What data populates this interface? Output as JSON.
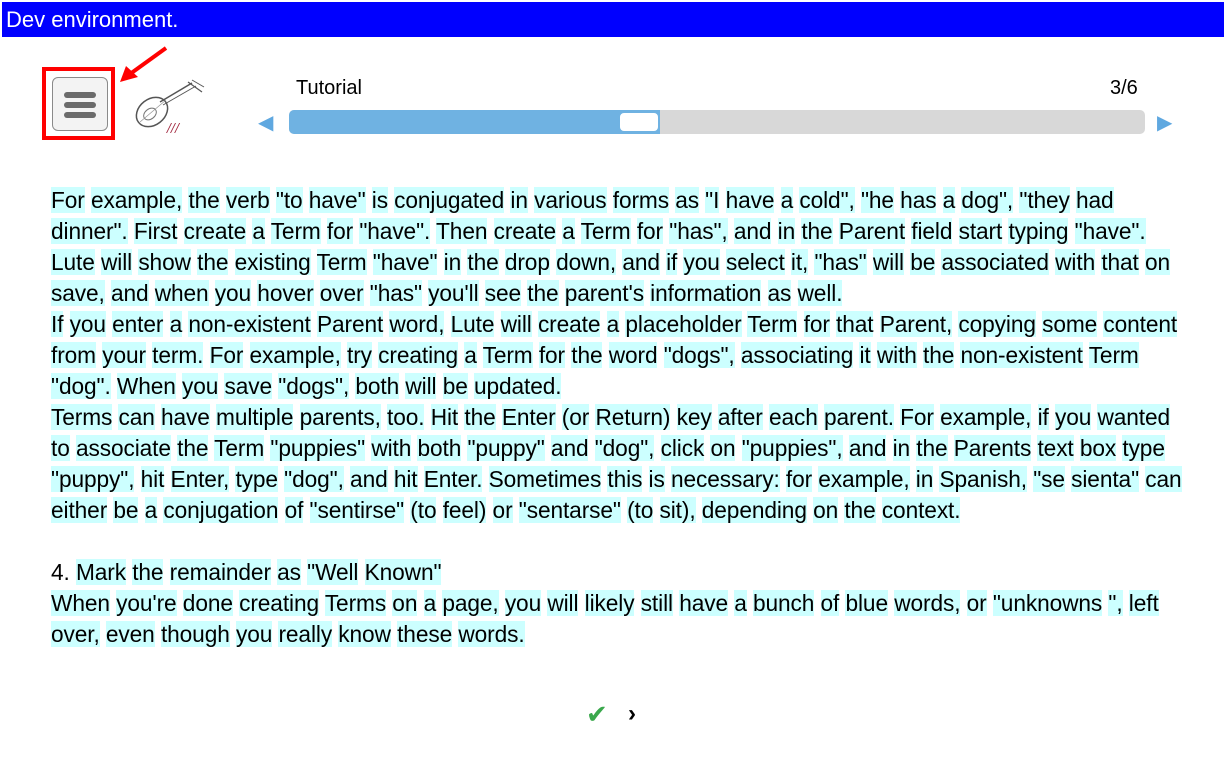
{
  "banner": {
    "text": "Dev environment."
  },
  "header": {
    "tutorial_title": "Tutorial",
    "page_count": "3/6",
    "prev_arrow": "◀",
    "next_arrow": "▶",
    "progress_fraction": 0.433
  },
  "reading": {
    "paragraphs": [
      "For example, the verb \"to have\" is conjugated in various forms as \"I have a cold\", \"he has a dog\", \"they had dinner\". First create a Term for \"have\". Then create a Term for \"has\", and in the Parent field start typing \"have\". Lute will show the existing Term \"have\" in the drop down, and if you select it, \"has\" will be associated with that on save, and when you hover over \"has\" you'll see the parent's information as well.",
      "If you enter a non-existent Parent word, Lute will create a placeholder Term for that Parent, copying some content from your term. For example, try creating a Term for the word \"dogs\", associating it with the non-existent Term \"dog\". When you save \"dogs\", both will be updated.",
      "Terms can have multiple parents, too. Hit the Enter (or Return) key after each parent. For example, if you wanted to associate the Term \"puppies\" with both \"puppy\" and \"dog\", click on \"puppies\", and in the Parents text box type \"puppy\", hit Enter, type \"dog\", and hit Enter. Sometimes this is necessary: for example, in Spanish, \"se sienta\" can either be a conjugation of \"sentirse\" (to feel) or \"sentarse\" (to sit), depending on the context.",
      "",
      "4. Mark the remainder as \"Well Known\"",
      "When you're done creating Terms on a page, you will likely still have a bunch of blue words, or \"unknowns \", left over, even though you really know these words."
    ],
    "unhighlighted_tokens": [
      "4."
    ]
  },
  "footer": {
    "done_icon": "✔",
    "next_icon": "›"
  },
  "icons": {
    "menu": "hamburger-icon",
    "logo": "lute-instrument-icon",
    "annotation": "red-arrow-icon"
  },
  "colors": {
    "banner_bg": "#0000ff",
    "word_highlight": "#ccffff",
    "progress_fill": "#6fb2e2",
    "progress_track": "#d8d8d8",
    "check": "#3aa84c",
    "annotation": "#ff0000"
  }
}
